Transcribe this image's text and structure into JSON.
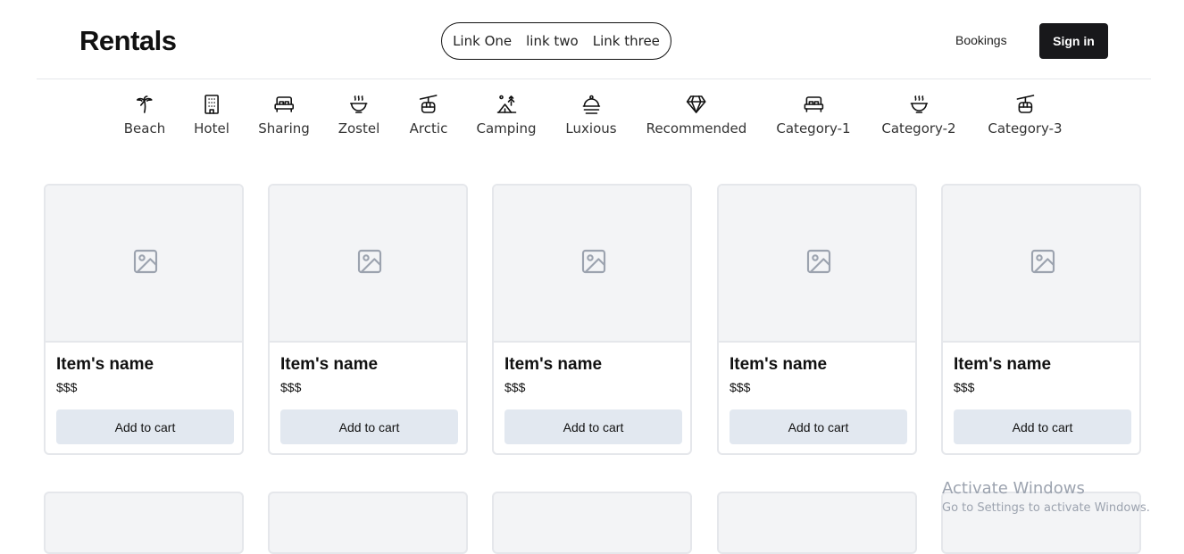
{
  "header": {
    "brand": "Rentals",
    "nav_links": [
      "Link One",
      "link two",
      "Link three"
    ],
    "bookings_label": "Bookings",
    "signin_label": "Sign in"
  },
  "categories": [
    {
      "label": "Beach",
      "icon": "palm-tree-icon"
    },
    {
      "label": "Hotel",
      "icon": "building-icon"
    },
    {
      "label": "Sharing",
      "icon": "bed-icon"
    },
    {
      "label": "Zostel",
      "icon": "hot-bowl-icon"
    },
    {
      "label": "Arctic",
      "icon": "cable-car-icon"
    },
    {
      "label": "Camping",
      "icon": "camping-icon"
    },
    {
      "label": "Luxious",
      "icon": "cloche-icon"
    },
    {
      "label": "Recommended",
      "icon": "diamond-icon"
    },
    {
      "label": "Category-1",
      "icon": "bed-icon"
    },
    {
      "label": "Category-2",
      "icon": "hot-bowl-icon"
    },
    {
      "label": "Category-3",
      "icon": "cable-car-icon"
    }
  ],
  "products": [
    {
      "name": "Item's name",
      "price": "$$$",
      "button": "Add to cart",
      "icon": "image-placeholder-icon"
    },
    {
      "name": "Item's name",
      "price": "$$$",
      "button": "Add to cart",
      "icon": "image-placeholder-icon"
    },
    {
      "name": "Item's name",
      "price": "$$$",
      "button": "Add to cart",
      "icon": "image-placeholder-icon"
    },
    {
      "name": "Item's name",
      "price": "$$$",
      "button": "Add to cart",
      "icon": "image-placeholder-icon"
    },
    {
      "name": "Item's name",
      "price": "$$$",
      "button": "Add to cart",
      "icon": "image-placeholder-icon"
    }
  ],
  "watermark": {
    "title": "Activate Windows",
    "subtitle": "Go to Settings to activate Windows."
  },
  "colors": {
    "primary_button": "#18181b",
    "secondary_button": "#e2e8f0",
    "placeholder_bg": "#f3f4f6",
    "border": "#e5e7eb"
  }
}
